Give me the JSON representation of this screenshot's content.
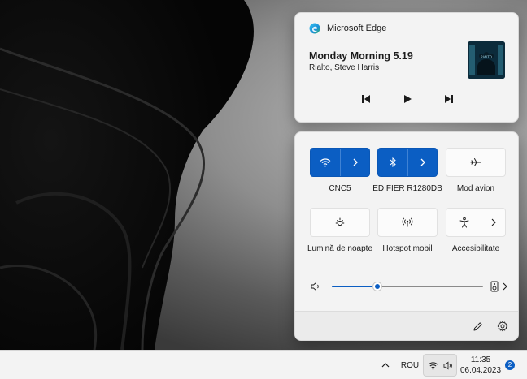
{
  "media": {
    "app_name": "Microsoft Edge",
    "track_title": "Monday Morning 5.19",
    "track_artist": "Rialto, Steve Harris",
    "album_art_text": "RIALTO",
    "icons": [
      "edge-icon",
      "previous-track-icon",
      "play-icon",
      "next-track-icon"
    ]
  },
  "quick_settings": {
    "tiles": [
      {
        "label": "CNC5",
        "icon": "wifi-icon",
        "state": "on",
        "has_arrow": true
      },
      {
        "label": "EDIFIER R1280DB",
        "icon": "bluetooth-icon",
        "state": "on",
        "has_arrow": true
      },
      {
        "label": "Mod avion",
        "icon": "airplane-icon",
        "state": "off",
        "has_arrow": false
      },
      {
        "label": "Lumină de noapte",
        "icon": "night-light-icon",
        "state": "off",
        "has_arrow": false
      },
      {
        "label": "Hotspot mobil",
        "icon": "hotspot-icon",
        "state": "off",
        "has_arrow": false
      },
      {
        "label": "Accesibilitate",
        "icon": "accessibility-icon",
        "state": "off",
        "has_arrow": true
      }
    ],
    "volume": {
      "level_percent": 30,
      "icons": [
        "speaker-icon",
        "audio-device-icon",
        "chevron-right-icon"
      ]
    },
    "footer_icons": [
      "edit-pencil-icon",
      "settings-gear-icon"
    ]
  },
  "taskbar": {
    "language": "ROU",
    "time": "11:35",
    "date": "06.04.2023",
    "notification_count": "2",
    "icons": [
      "chevron-up-icon",
      "wifi-icon",
      "speaker-icon"
    ]
  },
  "colors": {
    "accent": "#0b5ec3",
    "panel_bg": "#f3f3f3",
    "tile_off_bg": "#fbfbfb"
  }
}
